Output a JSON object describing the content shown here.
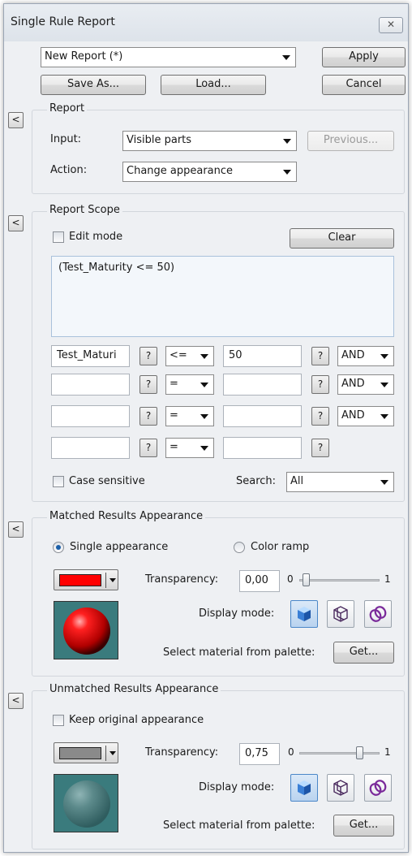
{
  "window": {
    "title": "Single Rule Report",
    "close_glyph": "✕"
  },
  "top": {
    "report_select": "New Report (*)",
    "apply_label": "Apply",
    "save_as_label": "Save As...",
    "load_label": "Load...",
    "cancel_label": "Cancel"
  },
  "report": {
    "group_label": "Report",
    "collapse_glyph": "<",
    "input_label": "Input:",
    "input_value": "Visible parts",
    "previous_label": "Previous...",
    "action_label": "Action:",
    "action_value": "Change appearance"
  },
  "scope": {
    "group_label": "Report Scope",
    "collapse_glyph": "<",
    "edit_mode_label": "Edit mode",
    "clear_label": "Clear",
    "expression": "(Test_Maturity <= 50)",
    "rows": [
      {
        "field": "Test_Maturi",
        "q1": "?",
        "op": "<=",
        "value": "50",
        "q2": "?",
        "logic": "AND"
      },
      {
        "field": "",
        "q1": "?",
        "op": "=",
        "value": "",
        "q2": "?",
        "logic": "AND"
      },
      {
        "field": "",
        "q1": "?",
        "op": "=",
        "value": "",
        "q2": "?",
        "logic": "AND"
      },
      {
        "field": "",
        "q1": "?",
        "op": "=",
        "value": "",
        "q2": "?",
        "logic": ""
      }
    ],
    "case_sensitive_label": "Case sensitive",
    "search_label": "Search:",
    "search_value": "All"
  },
  "matched": {
    "group_label": "Matched Results Appearance",
    "collapse_glyph": "<",
    "single_label": "Single appearance",
    "ramp_label": "Color ramp",
    "color": "#ff0000",
    "transparency_label": "Transparency:",
    "transparency_value": "0,00",
    "slider_min": "0",
    "slider_max": "1",
    "slider_level": 0.0,
    "display_mode_label": "Display mode:",
    "palette_label": "Select material from palette:",
    "get_label": "Get..."
  },
  "unmatched": {
    "group_label": "Unmatched Results Appearance",
    "collapse_glyph": "<",
    "keep_label": "Keep original appearance",
    "color": "#8a8a8a",
    "transparency_label": "Transparency:",
    "transparency_value": "0,75",
    "slider_min": "0",
    "slider_max": "1",
    "slider_level": 0.75,
    "display_mode_label": "Display mode:",
    "palette_label": "Select material from palette:",
    "get_label": "Get..."
  },
  "icons": {
    "display_modes": [
      "solid-shaded-cube-icon",
      "wireframe-cube-icon",
      "linked-rings-icon"
    ]
  }
}
